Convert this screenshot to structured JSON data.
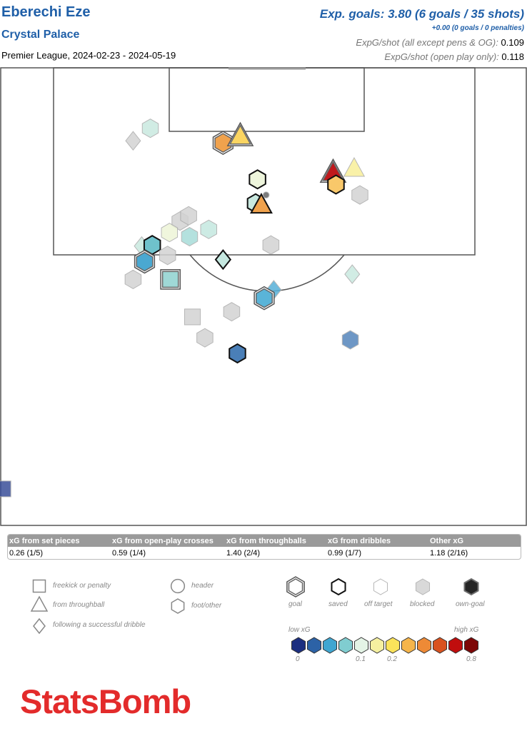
{
  "header": {
    "player": "Eberechi Eze",
    "team": "Crystal Palace",
    "competition": "Premier League, 2024-02-23 - 2024-05-19",
    "exp_goals": "Exp. goals: 3.80 (6 goals / 35 shots)",
    "penalties": "+0.00 (0 goals / 0 penalties)",
    "xg_per_shot_label": "ExpG/shot (all except pens & OG):",
    "xg_per_shot_value": "0.109",
    "xg_open_play_label": "ExpG/shot (open play only):",
    "xg_open_play_value": "0.118"
  },
  "summary_table": {
    "headers": [
      "xG from set pieces",
      "xG from open-play crosses",
      "xG from throughballs",
      "xG from dribbles",
      "Other xG"
    ],
    "values": [
      "0.26 (1/5)",
      "0.59 (1/4)",
      "1.40 (2/4)",
      "0.99 (1/7)",
      "1.18 (2/16)"
    ]
  },
  "legend": {
    "shape_types": [
      {
        "shape": "square",
        "label": "freekick or penalty"
      },
      {
        "shape": "triangle",
        "label": "from throughball"
      },
      {
        "shape": "diamond",
        "label": "following a successful dribble"
      },
      {
        "shape": "circle",
        "label": "header"
      },
      {
        "shape": "hexagon",
        "label": "foot/other"
      }
    ],
    "outcomes": [
      {
        "outcome": "goal",
        "label": "goal"
      },
      {
        "outcome": "saved",
        "label": "saved"
      },
      {
        "outcome": "off_target",
        "label": "off target"
      },
      {
        "outcome": "blocked",
        "label": "blocked"
      },
      {
        "outcome": "own_goal",
        "label": "own-goal"
      }
    ],
    "low_label": "low xG",
    "high_label": "high xG",
    "scale_colors": [
      "#1c2f80",
      "#2c62a6",
      "#3fa6d1",
      "#80cdd0",
      "#e4f4e6",
      "#f5f0a0",
      "#fbe35a",
      "#f6b54b",
      "#ee8a36",
      "#d9521f",
      "#c00d0d",
      "#7d0707"
    ],
    "scale_ticks": [
      "0",
      "0.1",
      "0.2",
      "0.8"
    ]
  },
  "colors": {
    "title": "#1f5fa8",
    "blocked": "#d3d3d3",
    "logo": "#e32b2b"
  },
  "chart_data": {
    "type": "scatter",
    "shots": [
      {
        "x": 113.0,
        "y": 26.0,
        "shape": "diamond",
        "outcome": "blocked",
        "xg": 0.05,
        "color": "#d3d3d3"
      },
      {
        "x": 114.2,
        "y": 27.8,
        "shape": "hexagon",
        "outcome": "off_target",
        "xg": 0.08,
        "color": "#c9e9e0"
      },
      {
        "x": 112.8,
        "y": 35.4,
        "shape": "hexagon",
        "outcome": "goal",
        "xg": 0.35,
        "color": "#f0a24d"
      },
      {
        "x": 113.4,
        "y": 37.2,
        "shape": "triangle",
        "outcome": "goal",
        "xg": 0.25,
        "color": "#fbd561"
      },
      {
        "x": 109.3,
        "y": 39.0,
        "shape": "hexagon",
        "outcome": "saved",
        "xg": 0.1,
        "color": "#eef5dc"
      },
      {
        "x": 107.0,
        "y": 38.8,
        "shape": "hexagon",
        "outcome": "saved",
        "xg": 0.08,
        "color": "#c9e9e0"
      },
      {
        "x": 106.8,
        "y": 39.4,
        "shape": "triangle",
        "outcome": "saved",
        "xg": 0.35,
        "color": "#f0a24d"
      },
      {
        "x": 107.8,
        "y": 39.9,
        "shape": "circle",
        "outcome": "blocked",
        "xg": 0.02,
        "color": "#666666"
      },
      {
        "x": 109.9,
        "y": 46.9,
        "shape": "triangle",
        "outcome": "goal",
        "xg": 0.7,
        "color": "#c0191c"
      },
      {
        "x": 108.8,
        "y": 47.2,
        "shape": "hexagon",
        "outcome": "saved",
        "xg": 0.3,
        "color": "#f9c86a"
      },
      {
        "x": 110.3,
        "y": 49.1,
        "shape": "triangle",
        "outcome": "off_target",
        "xg": 0.15,
        "color": "#f8ef99"
      },
      {
        "x": 107.8,
        "y": 49.7,
        "shape": "hexagon",
        "outcome": "blocked",
        "xg": 0.06,
        "color": "#d3d3d3"
      },
      {
        "x": 105.3,
        "y": 30.9,
        "shape": "hexagon",
        "outcome": "blocked",
        "xg": 0.05,
        "color": "#d3d3d3"
      },
      {
        "x": 105.8,
        "y": 31.8,
        "shape": "hexagon",
        "outcome": "blocked",
        "xg": 0.05,
        "color": "#d3d3d3"
      },
      {
        "x": 104.2,
        "y": 29.8,
        "shape": "hexagon",
        "outcome": "off_target",
        "xg": 0.1,
        "color": "#eef5d8"
      },
      {
        "x": 103.8,
        "y": 31.9,
        "shape": "hexagon",
        "outcome": "off_target",
        "xg": 0.06,
        "color": "#a8dcd9"
      },
      {
        "x": 104.5,
        "y": 33.9,
        "shape": "hexagon",
        "outcome": "off_target",
        "xg": 0.08,
        "color": "#c5e8e0"
      },
      {
        "x": 102.9,
        "y": 26.9,
        "shape": "diamond",
        "outcome": "off_target",
        "xg": 0.08,
        "color": "#c9e9e0"
      },
      {
        "x": 103.0,
        "y": 28.0,
        "shape": "hexagon",
        "outcome": "saved",
        "xg": 0.05,
        "color": "#6fc2cc"
      },
      {
        "x": 102.0,
        "y": 29.6,
        "shape": "hexagon",
        "outcome": "blocked",
        "xg": 0.05,
        "color": "#d3d3d3"
      },
      {
        "x": 101.4,
        "y": 27.2,
        "shape": "hexagon",
        "outcome": "goal",
        "xg": 0.04,
        "color": "#4aa8d1"
      },
      {
        "x": 99.7,
        "y": 26.0,
        "shape": "hexagon",
        "outcome": "blocked",
        "xg": 0.04,
        "color": "#d3d3d3"
      },
      {
        "x": 99.7,
        "y": 29.9,
        "shape": "square",
        "outcome": "goal",
        "xg": 0.06,
        "color": "#9fd8d6"
      },
      {
        "x": 101.6,
        "y": 35.4,
        "shape": "diamond",
        "outcome": "saved",
        "xg": 0.08,
        "color": "#c5e8e0"
      },
      {
        "x": 103.0,
        "y": 40.4,
        "shape": "hexagon",
        "outcome": "blocked",
        "xg": 0.06,
        "color": "#d3d3d3"
      },
      {
        "x": 100.2,
        "y": 48.9,
        "shape": "diamond",
        "outcome": "off_target",
        "xg": 0.08,
        "color": "#c9e9e0"
      },
      {
        "x": 98.7,
        "y": 40.7,
        "shape": "diamond",
        "outcome": "off_target",
        "xg": 0.04,
        "color": "#57b0d8"
      },
      {
        "x": 97.9,
        "y": 39.7,
        "shape": "hexagon",
        "outcome": "goal",
        "xg": 0.04,
        "color": "#5ab4d8"
      },
      {
        "x": 96.1,
        "y": 32.2,
        "shape": "square",
        "outcome": "blocked",
        "xg": 0.04,
        "color": "#d3d3d3"
      },
      {
        "x": 96.6,
        "y": 36.3,
        "shape": "hexagon",
        "outcome": "blocked",
        "xg": 0.04,
        "color": "#d3d3d3"
      },
      {
        "x": 94.1,
        "y": 33.5,
        "shape": "hexagon",
        "outcome": "blocked",
        "xg": 0.03,
        "color": "#d3d3d3"
      },
      {
        "x": 92.6,
        "y": 36.9,
        "shape": "hexagon",
        "outcome": "saved",
        "xg": 0.02,
        "color": "#4a7fb8"
      },
      {
        "x": 93.9,
        "y": 48.7,
        "shape": "hexagon",
        "outcome": "off_target",
        "xg": 0.02,
        "color": "#5585bb"
      },
      {
        "x": 79.6,
        "y": 12.4,
        "shape": "square",
        "outcome": "off_target",
        "xg": 0.01,
        "color": "#3a4f9a"
      }
    ]
  },
  "logo": {
    "text": "StatsBomb"
  }
}
